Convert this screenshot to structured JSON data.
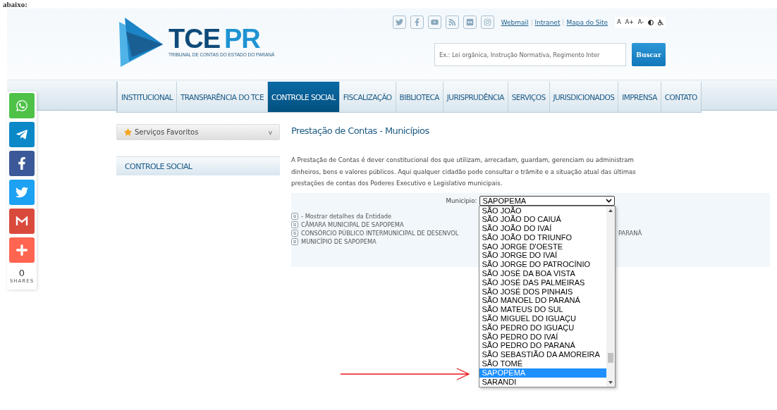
{
  "caption_fragment": "abaixo:",
  "header": {
    "logo": {
      "title_dark": "TCE",
      "title_light": "PR",
      "subtitle": "TRIBUNAL DE CONTAS DO ESTADO DO PARANÁ"
    },
    "links": [
      "Webmail",
      "Intranet",
      "Mapa do Site"
    ],
    "font_buttons": [
      "A",
      "A+",
      "A-"
    ],
    "search": {
      "placeholder": "Ex.: Lei orgânica, Instrução Normativa, Regimento Inter",
      "button": "Buscar"
    }
  },
  "nav": [
    {
      "label": "INSTITUCIONAL",
      "selected": false
    },
    {
      "label": "TRANSPARÊNCIA DO TCE",
      "selected": false
    },
    {
      "label": "CONTROLE SOCIAL",
      "selected": true
    },
    {
      "label": "FISCALIZAÇÃO",
      "selected": false
    },
    {
      "label": "BIBLIOTECA",
      "selected": false
    },
    {
      "label": "JURISPRUDÊNCIA",
      "selected": false
    },
    {
      "label": "SERVIÇOS",
      "selected": false
    },
    {
      "label": "JURISDICIONADOS",
      "selected": false
    },
    {
      "label": "IMPRENSA",
      "selected": false
    },
    {
      "label": "CONTATO",
      "selected": false
    }
  ],
  "sidebar": {
    "favorites": {
      "label": "Serviços Favoritos",
      "toggle": "v"
    },
    "section_title": "CONTROLE SOCIAL"
  },
  "main": {
    "title": "Prestação de Contas - Municípios",
    "description": "A Prestação de Contas é dever constitucional dos que utilizam, arrecadam, guardam, gerenciam ou administram dinheiros, bens e valores públicos. Aqui qualquer cidadão pode consultar o trâmite e a situação atual das últimas prestações de contas dos Poderes Executivo e Legislativo municipais.",
    "filter": {
      "label": "Município:",
      "value": "SAPOPEMA",
      "expanded": true
    },
    "entities_hint": "- Mostrar detalhes da Entidade",
    "entities": [
      {
        "text": "CÂMARA MUNICIPAL DE SAPOPEMA"
      },
      {
        "text": "CONSÓRCIO PÚBLICO INTERMUNICIPAL DE DESENVOL",
        "tail": "PARANÁ"
      },
      {
        "text": "MUNICÍPIO DE SAPOPEMA"
      }
    ],
    "options": [
      {
        "label": "SÃO JOÃO",
        "selected": false
      },
      {
        "label": "SÃO JOÃO DO CAIUÁ",
        "selected": false
      },
      {
        "label": "SÃO JOÃO DO IVAÍ",
        "selected": false
      },
      {
        "label": "SÃO JOÃO DO TRIUNFO",
        "selected": false
      },
      {
        "label": "SAO JORGE D'OESTE",
        "selected": false
      },
      {
        "label": "SÃO JORGE DO IVAÍ",
        "selected": false
      },
      {
        "label": "SÃO JORGE DO PATROCÍNIO",
        "selected": false
      },
      {
        "label": "SÃO JOSÉ DA BOA VISTA",
        "selected": false
      },
      {
        "label": "SÃO JOSÉ DAS PALMEIRAS",
        "selected": false
      },
      {
        "label": "SÃO JOSÉ DOS PINHAIS",
        "selected": false
      },
      {
        "label": "SÃO MANOEL DO PARANÁ",
        "selected": false
      },
      {
        "label": "SÃO MATEUS DO SUL",
        "selected": false
      },
      {
        "label": "SÃO MIGUEL DO IGUAÇU",
        "selected": false
      },
      {
        "label": "SÃO PEDRO DO IGUAÇU",
        "selected": false
      },
      {
        "label": "SÃO PEDRO DO IVAÍ",
        "selected": false
      },
      {
        "label": "SÃO PEDRO DO PARANÁ",
        "selected": false
      },
      {
        "label": "SÃO SEBASTIÃO DA AMOREIRA",
        "selected": false
      },
      {
        "label": "SÃO TOMÉ",
        "selected": false
      },
      {
        "label": "SAPOPEMA",
        "selected": true
      },
      {
        "label": "SARANDI",
        "selected": false
      }
    ]
  },
  "share": {
    "count": "0",
    "label": "SHARES"
  }
}
